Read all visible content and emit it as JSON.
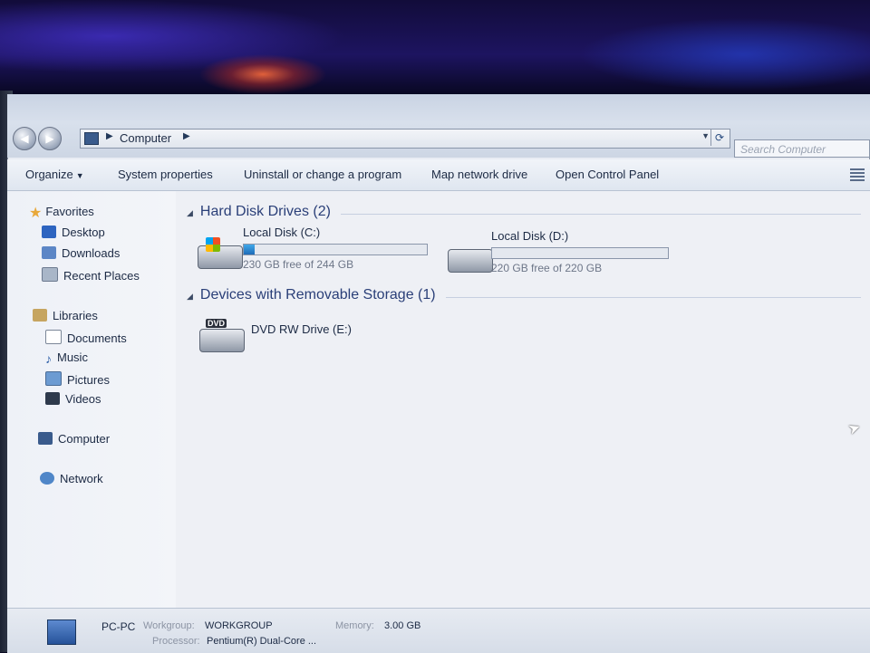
{
  "address": {
    "crumb": "Computer",
    "search_placeholder": "Search Computer"
  },
  "toolbar": {
    "organize": "Organize",
    "system_properties": "System properties",
    "uninstall": "Uninstall or change a program",
    "map_network_drive": "Map network drive",
    "open_control_panel": "Open Control Panel"
  },
  "nav": {
    "favorites": "Favorites",
    "desktop": "Desktop",
    "downloads": "Downloads",
    "recent_places": "Recent Places",
    "libraries": "Libraries",
    "documents": "Documents",
    "music": "Music",
    "pictures": "Pictures",
    "videos": "Videos",
    "computer": "Computer",
    "network": "Network"
  },
  "content": {
    "hard_disk_group": "Hard Disk Drives (2)",
    "removable_group": "Devices with Removable Storage (1)",
    "drives": [
      {
        "name": "Local Disk (C:)",
        "free_text": "230 GB free of 244 GB",
        "used_fraction": 0.057
      },
      {
        "name": "Local Disk (D:)",
        "free_text": "220 GB free of 220 GB",
        "used_fraction": 0.0
      }
    ],
    "dvd": {
      "name": "DVD RW Drive (E:)",
      "tag": "DVD"
    }
  },
  "details": {
    "pc_name": "PC-PC",
    "workgroup_label": "Workgroup:",
    "workgroup_value": "WORKGROUP",
    "memory_label": "Memory:",
    "memory_value": "3.00 GB",
    "processor_label": "Processor:",
    "processor_value": "Pentium(R) Dual-Core ..."
  },
  "colors": {
    "accent": "#2a3f78",
    "drive_fill": "#1e6cb8"
  }
}
